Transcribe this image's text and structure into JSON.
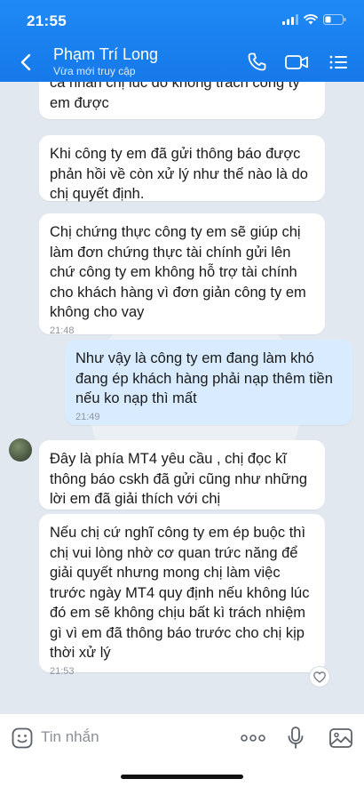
{
  "status_bar": {
    "time": "21:55"
  },
  "header": {
    "contact_name": "Phạm Trí Long",
    "contact_status": "Vừa mới truy cập"
  },
  "messages": [
    {
      "from": "them",
      "text": "cá nhân chị lúc đó không trách công ty em được",
      "time": ""
    },
    {
      "from": "them",
      "text": "Khi công ty em đã gửi thông báo được phản hồi về còn xử lý như thế nào là do chị quyết định.",
      "time": ""
    },
    {
      "from": "them",
      "text": "Chị chứng thực công ty em sẽ giúp chị làm đơn chứng thực tài chính gửi lên chứ công ty em không hỗ trợ tài chính cho khách hàng vì đơn giản công ty em không cho vay",
      "time": "21:48"
    },
    {
      "from": "me",
      "text": "Như vậy là công ty em đang làm khó đang ép khách hàng phải nạp thêm tiền nếu ko nạp thì mất",
      "time": "21:49"
    },
    {
      "from": "them",
      "text": "Đây là phía MT4 yêu cầu , chị đọc kĩ thông báo cskh đã gửi cũng như những lời em đã giải thích với chị",
      "time": ""
    },
    {
      "from": "them",
      "text": "Nếu chị cứ nghĩ công ty em ép buộc thì chị vui lòng nhờ cơ quan trức năng để giải quyết nhưng mong chị làm việc trước ngày MT4 quy định nếu không lúc đó em sẽ không chịu bất kì trách nhiệm gì vì em đã thông báo trước cho chị kịp thời xử lý",
      "time": "21:53"
    }
  ],
  "input": {
    "placeholder": "Tin nhắn",
    "value": ""
  },
  "icons": {
    "back": "chevron-left-icon",
    "call": "phone-icon",
    "video": "video-camera-icon",
    "menu": "list-menu-icon",
    "emoji": "emoji-icon",
    "more": "more-dots-icon",
    "mic": "microphone-icon",
    "image": "image-icon",
    "like": "heart-icon"
  },
  "colors": {
    "header": "#1679e9",
    "my_bubble": "#d9ecff",
    "their_bubble": "#ffffff",
    "chat_bg": "#e2e8ef"
  }
}
